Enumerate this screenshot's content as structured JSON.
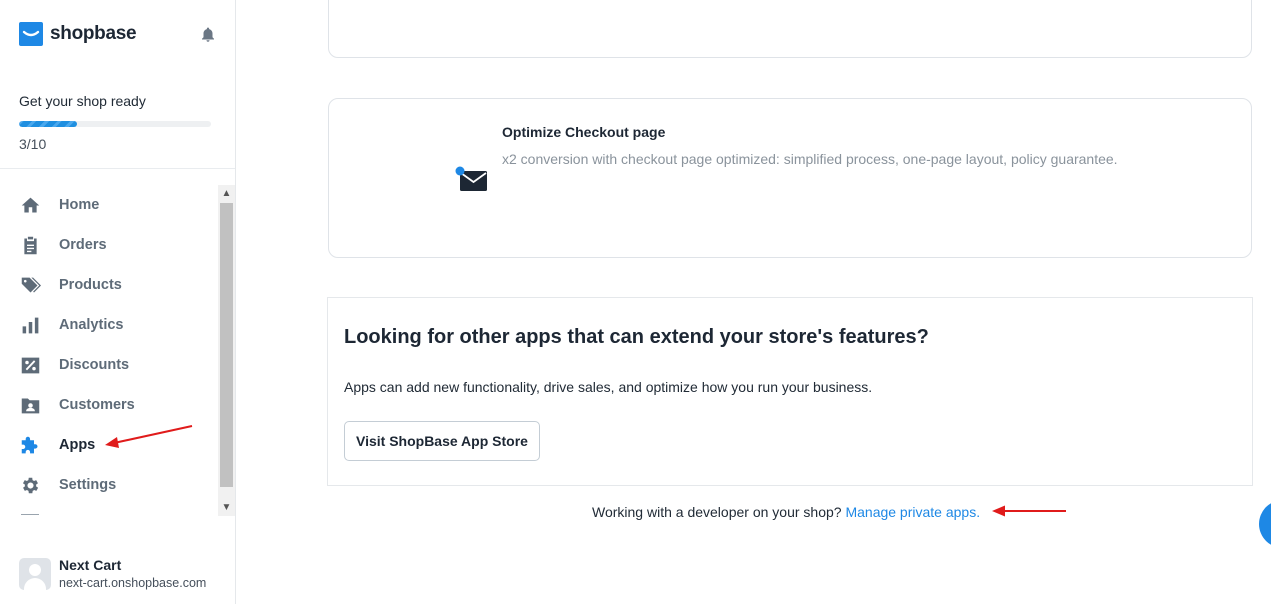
{
  "brand": {
    "name": "shopbase"
  },
  "setup": {
    "title": "Get your shop ready",
    "count": "3/10",
    "progress": 0.3
  },
  "sidebar": {
    "items": [
      {
        "label": "Home",
        "icon": "home-icon"
      },
      {
        "label": "Orders",
        "icon": "clipboard-icon"
      },
      {
        "label": "Products",
        "icon": "tag-icon"
      },
      {
        "label": "Analytics",
        "icon": "bar-chart-icon"
      },
      {
        "label": "Discounts",
        "icon": "percent-icon"
      },
      {
        "label": "Customers",
        "icon": "contact-card-icon"
      },
      {
        "label": "Apps",
        "icon": "puzzle-icon",
        "active": true
      },
      {
        "label": "Settings",
        "icon": "gear-icon"
      }
    ]
  },
  "account": {
    "name": "Next Cart",
    "domain": "next-cart.onshopbase.com"
  },
  "feature": {
    "title": "Optimize Checkout page",
    "description": "x2 conversion with checkout page optimized: simplified process, one-page layout, policy guarantee.",
    "icon": "envelope-icon"
  },
  "apps_card": {
    "heading": "Looking for other apps that can extend your store's features?",
    "description": "Apps can add new functionality, drive sales, and optimize how you run your business.",
    "button_label": "Visit ShopBase App Store"
  },
  "developer": {
    "text": "Working with a developer on your shop? ",
    "link_label": "Manage private apps."
  },
  "colors": {
    "accent": "#1e88e5",
    "annotation_arrow": "#e01b1b",
    "active_icon": "#1e88e5"
  }
}
